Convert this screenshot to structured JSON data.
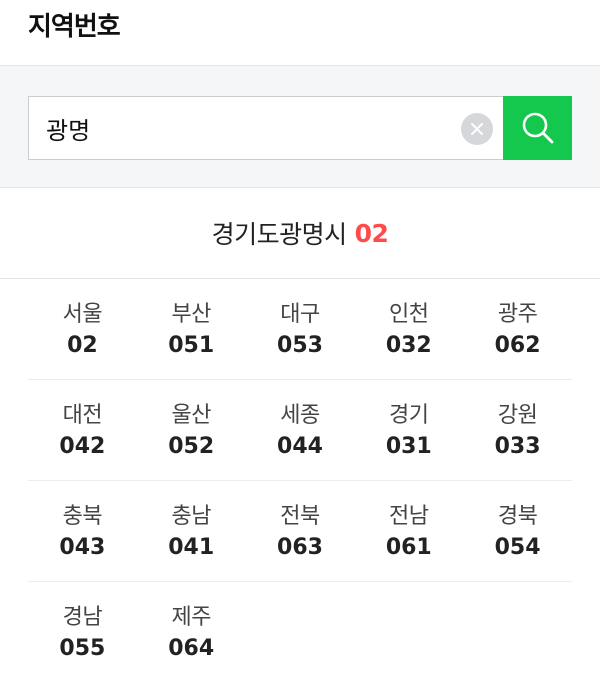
{
  "header": {
    "title": "지역번호"
  },
  "search": {
    "value": "광명",
    "placeholder": ""
  },
  "result": {
    "region": "경기도광명시",
    "code": "02"
  },
  "regions": [
    [
      {
        "name": "서울",
        "code": "02"
      },
      {
        "name": "부산",
        "code": "051"
      },
      {
        "name": "대구",
        "code": "053"
      },
      {
        "name": "인천",
        "code": "032"
      },
      {
        "name": "광주",
        "code": "062"
      }
    ],
    [
      {
        "name": "대전",
        "code": "042"
      },
      {
        "name": "울산",
        "code": "052"
      },
      {
        "name": "세종",
        "code": "044"
      },
      {
        "name": "경기",
        "code": "031"
      },
      {
        "name": "강원",
        "code": "033"
      }
    ],
    [
      {
        "name": "충북",
        "code": "043"
      },
      {
        "name": "충남",
        "code": "041"
      },
      {
        "name": "전북",
        "code": "063"
      },
      {
        "name": "전남",
        "code": "061"
      },
      {
        "name": "경북",
        "code": "054"
      }
    ],
    [
      {
        "name": "경남",
        "code": "055"
      },
      {
        "name": "제주",
        "code": "064"
      }
    ]
  ],
  "icons": {
    "clear": "close-icon",
    "search": "search-icon"
  },
  "colors": {
    "accent": "#13c84d",
    "code_highlight": "#ff4b4b"
  }
}
